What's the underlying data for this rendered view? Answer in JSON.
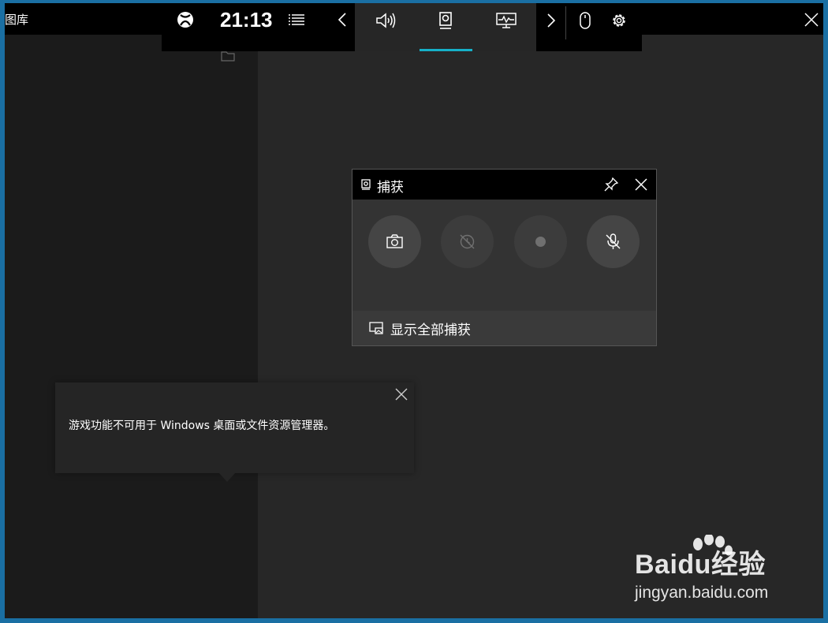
{
  "gallery": {
    "label": "图库"
  },
  "xbox_bar": {
    "time": "21:13"
  },
  "capture_widget": {
    "title": "捕获",
    "footer_label": "显示全部捕获"
  },
  "toast": {
    "message": "游戏功能不可用于 Windows 桌面或文件资源管理器。"
  },
  "watermark": {
    "brand": "Baidu经验",
    "url": "jingyan.baidu.com"
  },
  "colors": {
    "accent": "#16b0c8",
    "frame": "#1a6fa3",
    "bar": "#000000"
  },
  "icons": [
    "xbox-icon",
    "menu-icon",
    "chevron-left-icon",
    "audio-icon",
    "capture-icon",
    "performance-icon",
    "chevron-right-icon",
    "mouse-icon",
    "gear-icon",
    "close-icon",
    "folder-icon",
    "pin-icon",
    "camera-icon",
    "record-last-icon",
    "record-icon",
    "mic-off-icon",
    "gallery-icon"
  ]
}
